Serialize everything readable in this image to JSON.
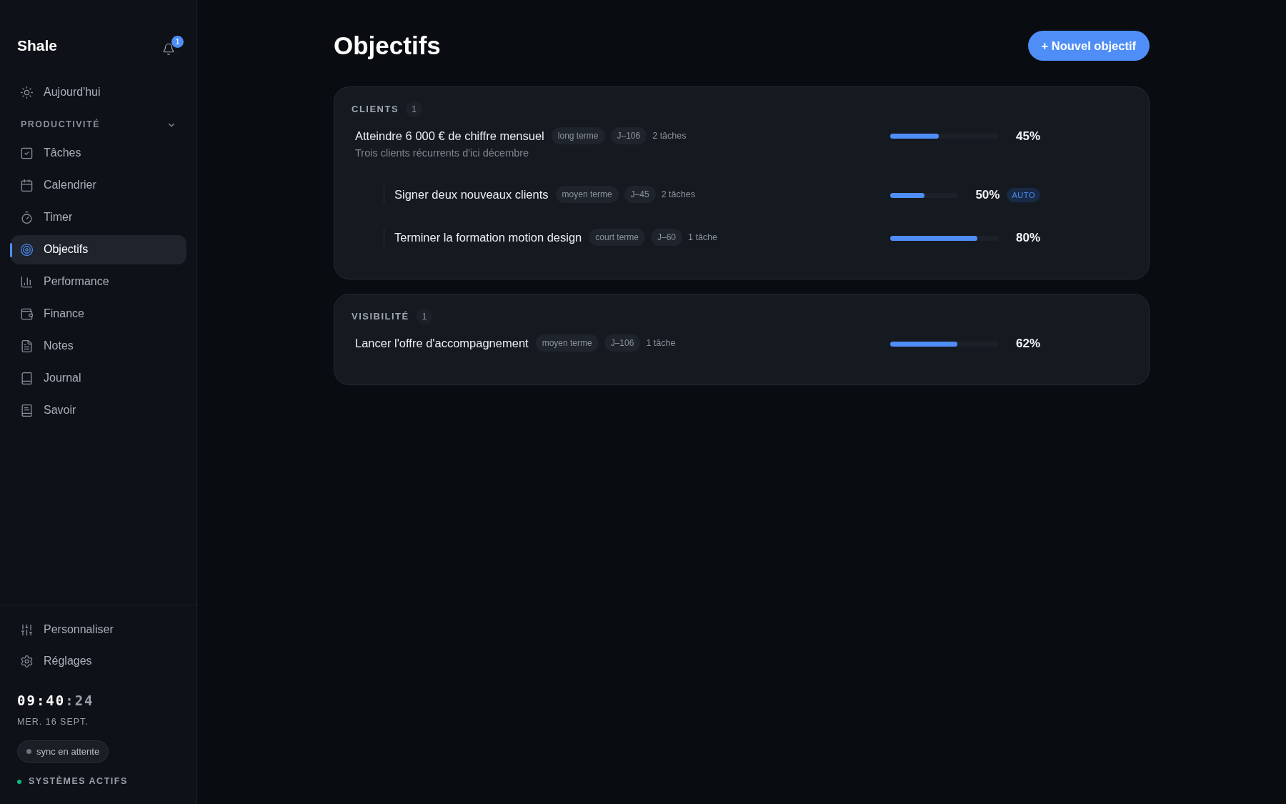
{
  "app": {
    "name": "Shale",
    "notifications": "1"
  },
  "sidebar": {
    "top_items": [
      {
        "label": "Aujourd'hui",
        "selected": false
      }
    ],
    "section": {
      "title": "PRODUCTIVITÉ",
      "expanded": true,
      "items": [
        {
          "label": "Tâches",
          "selected": false
        },
        {
          "label": "Calendrier",
          "selected": false
        },
        {
          "label": "Timer",
          "selected": false
        },
        {
          "label": "Objectifs",
          "selected": true
        },
        {
          "label": "Performance",
          "selected": false
        },
        {
          "label": "Finance",
          "selected": false
        },
        {
          "label": "Notes",
          "selected": false
        },
        {
          "label": "Journal",
          "selected": false
        },
        {
          "label": "Savoir",
          "selected": false
        }
      ]
    },
    "bottom_items": [
      {
        "label": "Personnaliser",
        "selected": false
      },
      {
        "label": "Réglages",
        "selected": false
      }
    ],
    "clock": {
      "hours_minutes": "09:40",
      "seconds": ":24",
      "date": "MER. 16 SEPT."
    },
    "sync": {
      "label": "sync en attente",
      "color": "#6b7280"
    },
    "status": {
      "label": "SYSTÈMES ACTIFS",
      "color": "#10b981"
    }
  },
  "page": {
    "title": "Objectifs",
    "new_button": "+ Nouvel objectif"
  },
  "groups": [
    {
      "title": "CLIENTS",
      "count": "1",
      "goals": [
        {
          "title": "Atteindre 6 000 € de chiffre mensuel",
          "subtitle": "Trois clients récurrents d'ici décembre",
          "horizon": "long terme",
          "deadline": "J–106",
          "tasks": "2 tâches",
          "level": 0.45,
          "percent": "45%",
          "children": [
            {
              "title": "Signer deux nouveaux clients",
              "horizon": "moyen terme",
              "deadline": "J–45",
              "tasks": "2 tâches",
              "level": 0.5,
              "percent": "50%",
              "auto": "AUTO"
            },
            {
              "title": "Terminer la formation motion design",
              "horizon": "court terme",
              "deadline": "J–60",
              "tasks": "1 tâche",
              "level": 0.8,
              "percent": "80%"
            }
          ]
        }
      ]
    },
    {
      "title": "VISIBILITÉ",
      "count": "1",
      "goals": [
        {
          "title": "Lancer l'offre d'accompagnement",
          "horizon": "moyen terme",
          "deadline": "J–106",
          "tasks": "1 tâche",
          "level": 0.62,
          "percent": "62%"
        }
      ]
    }
  ]
}
